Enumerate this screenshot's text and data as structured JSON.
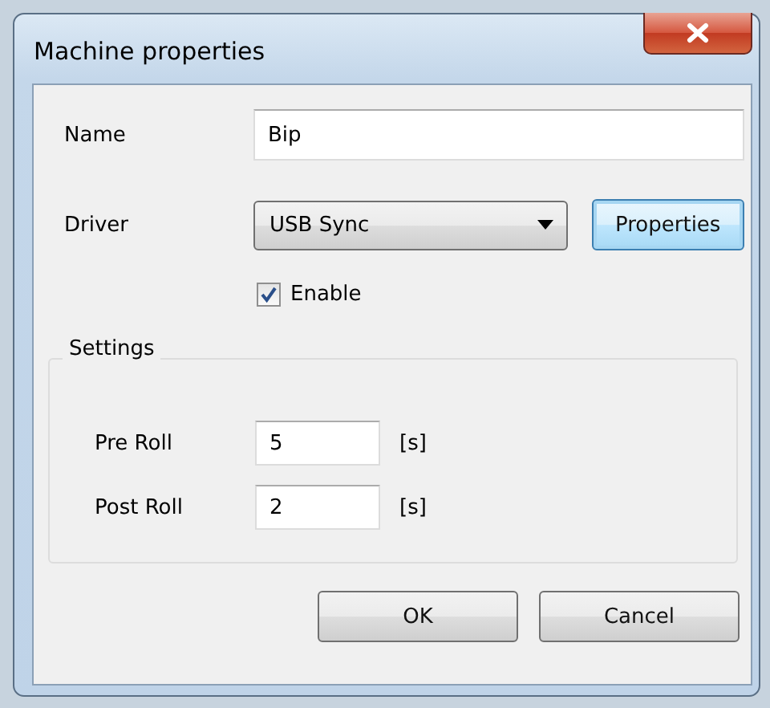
{
  "window": {
    "title": "Machine properties"
  },
  "name": {
    "label": "Name",
    "value": "Bip"
  },
  "driver": {
    "label": "Driver",
    "value": "USB Sync",
    "button": "Properties"
  },
  "enable": {
    "label": "Enable",
    "checked": true
  },
  "settings": {
    "title": "Settings",
    "rows": [
      {
        "label": "Pre Roll",
        "value": "5",
        "unit": "[s]"
      },
      {
        "label": "Post Roll",
        "value": "2",
        "unit": "[s]"
      }
    ]
  },
  "buttons": [
    "OK",
    "Cancel"
  ]
}
